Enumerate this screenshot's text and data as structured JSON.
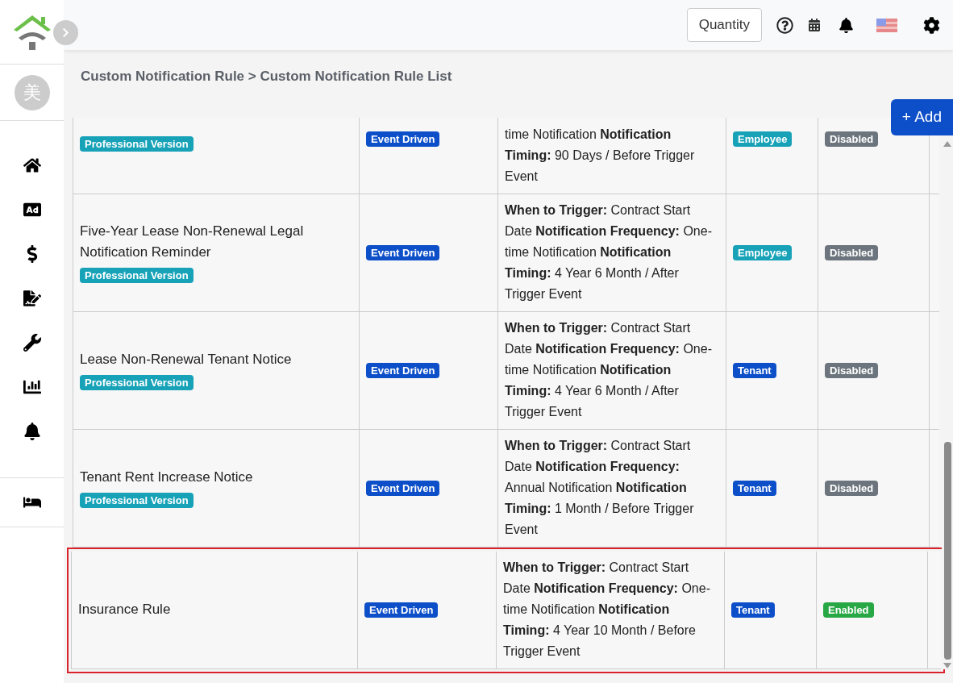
{
  "sidebar": {
    "avatar": "美"
  },
  "header": {
    "quantity_button": "Quantity"
  },
  "breadcrumb": "Custom Notification Rule > Custom Notification Rule List",
  "add_button": "+ Add",
  "rows": [
    {
      "name": "",
      "edition": "Professional Version",
      "type": "Event Driven",
      "details": "time Notification **Notification Timing:** 90 Days / Before Trigger Event",
      "receiver": {
        "text": "Employee",
        "color": "#17a2b8"
      },
      "status": {
        "text": "Disabled",
        "color": "#6c757d"
      },
      "highlighted": false
    },
    {
      "name": "Five-Year Lease Non-Renewal Legal Notification Reminder",
      "edition": "Professional Version",
      "type": "Event Driven",
      "details": "**When to Trigger:** Contract Start Date **Notification Frequency:** One-time Notification **Notification Timing:** 4 Year 6 Month / After Trigger Event",
      "receiver": {
        "text": "Employee",
        "color": "#17a2b8"
      },
      "status": {
        "text": "Disabled",
        "color": "#6c757d"
      },
      "highlighted": false
    },
    {
      "name": "Lease Non-Renewal Tenant Notice",
      "edition": "Professional Version",
      "type": "Event Driven",
      "details": "**When to Trigger:** Contract Start Date **Notification Frequency:** One-time Notification **Notification Timing:** 4 Year 6 Month / After Trigger Event",
      "receiver": {
        "text": "Tenant",
        "color": "#0d4fc9"
      },
      "status": {
        "text": "Disabled",
        "color": "#6c757d"
      },
      "highlighted": false
    },
    {
      "name": "Tenant Rent Increase Notice",
      "edition": "Professional Version",
      "type": "Event Driven",
      "details": "**When to Trigger:** Contract Start Date **Notification Frequency:** Annual Notification **Notification Timing:** 1 Month / Before Trigger Event",
      "receiver": {
        "text": "Tenant",
        "color": "#0d4fc9"
      },
      "status": {
        "text": "Disabled",
        "color": "#6c757d"
      },
      "highlighted": false
    },
    {
      "name": "Insurance Rule",
      "type": "Event Driven",
      "details": "**When to Trigger:** Contract Start Date **Notification Frequency:** One-time Notification **Notification Timing:** 4 Year 10 Month / Before Trigger Event",
      "receiver": {
        "text": "Tenant",
        "color": "#0d4fc9"
      },
      "status": {
        "text": "Enabled",
        "color": "#28a745"
      },
      "highlighted": true
    }
  ]
}
